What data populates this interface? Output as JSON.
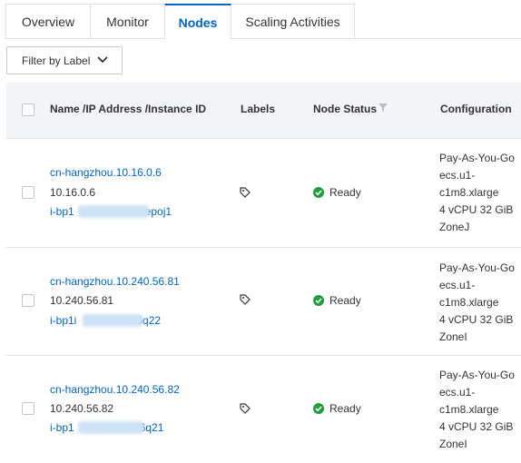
{
  "tabs": [
    {
      "label": "Overview"
    },
    {
      "label": "Monitor"
    },
    {
      "label": "Nodes"
    },
    {
      "label": "Scaling Activities"
    }
  ],
  "filter": {
    "label": "Filter by Label"
  },
  "table": {
    "columns": [
      "Name /IP Address /Instance ID",
      "Labels",
      "Node Status",
      "Configuration"
    ],
    "rows": [
      {
        "name": "cn-hangzhou.10.16.0.6",
        "ip": "10.16.0.6",
        "instance_prefix": "i-bp1",
        "instance_suffix": "epoj1",
        "status": "Ready",
        "config": [
          "Pay-As-You-Go",
          "ecs.u1-",
          "c1m8.xlarge",
          "4 vCPU 32 GiB",
          "ZoneJ"
        ]
      },
      {
        "name": "cn-hangzhou.10.240.56.81",
        "ip": "10.240.56.81",
        "instance_prefix": "i-bp1i",
        "instance_suffix": "6q22",
        "status": "Ready",
        "config": [
          "Pay-As-You-Go",
          "ecs.u1-",
          "c1m8.xlarge",
          "4 vCPU 32 GiB",
          "ZoneI"
        ]
      },
      {
        "name": "cn-hangzhou.10.240.56.82",
        "ip": "10.240.56.82",
        "instance_prefix": "i-bp1",
        "instance_suffix": "6q21",
        "status": "Ready",
        "config": [
          "Pay-As-You-Go",
          "ecs.u1-",
          "c1m8.xlarge",
          "4 vCPU 32 GiB",
          "ZoneI"
        ]
      }
    ]
  },
  "colors": {
    "accent": "#0064c8",
    "ready": "#1e9e3c",
    "highlight": "#e05050"
  },
  "icons": {
    "filter_chevron": "chevron-down-icon",
    "label": "tag-icon",
    "status": "check-circle-icon",
    "sort": "filter-icon"
  }
}
